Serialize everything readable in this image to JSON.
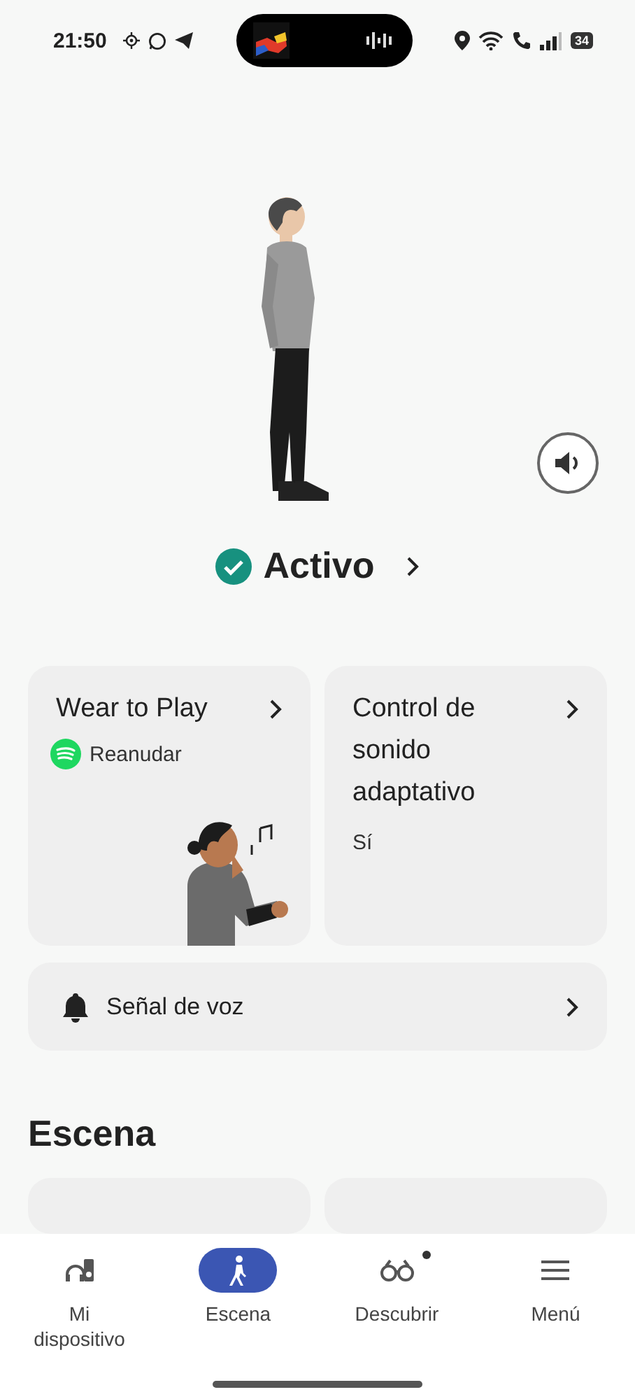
{
  "status_bar": {
    "time": "21:50",
    "battery": "34"
  },
  "hero": {
    "status": "Activo"
  },
  "cards": [
    {
      "kind": "app",
      "title": "Wear to Play",
      "subtitle": "Reanudar"
    },
    {
      "kind": "plain",
      "title": "Control de sonido adaptativo",
      "subtitle": "Sí"
    }
  ],
  "voice_row": {
    "label": "Señal de voz"
  },
  "section_title": "Escena",
  "nav": [
    {
      "kind": "device",
      "label": "Mi dispositivo",
      "selected": false,
      "dot": false
    },
    {
      "kind": "scene",
      "label": "Escena",
      "selected": true,
      "dot": false
    },
    {
      "kind": "discover",
      "label": "Descubrir",
      "selected": false,
      "dot": true
    },
    {
      "kind": "menu",
      "label": "Menú",
      "selected": false,
      "dot": false
    }
  ]
}
